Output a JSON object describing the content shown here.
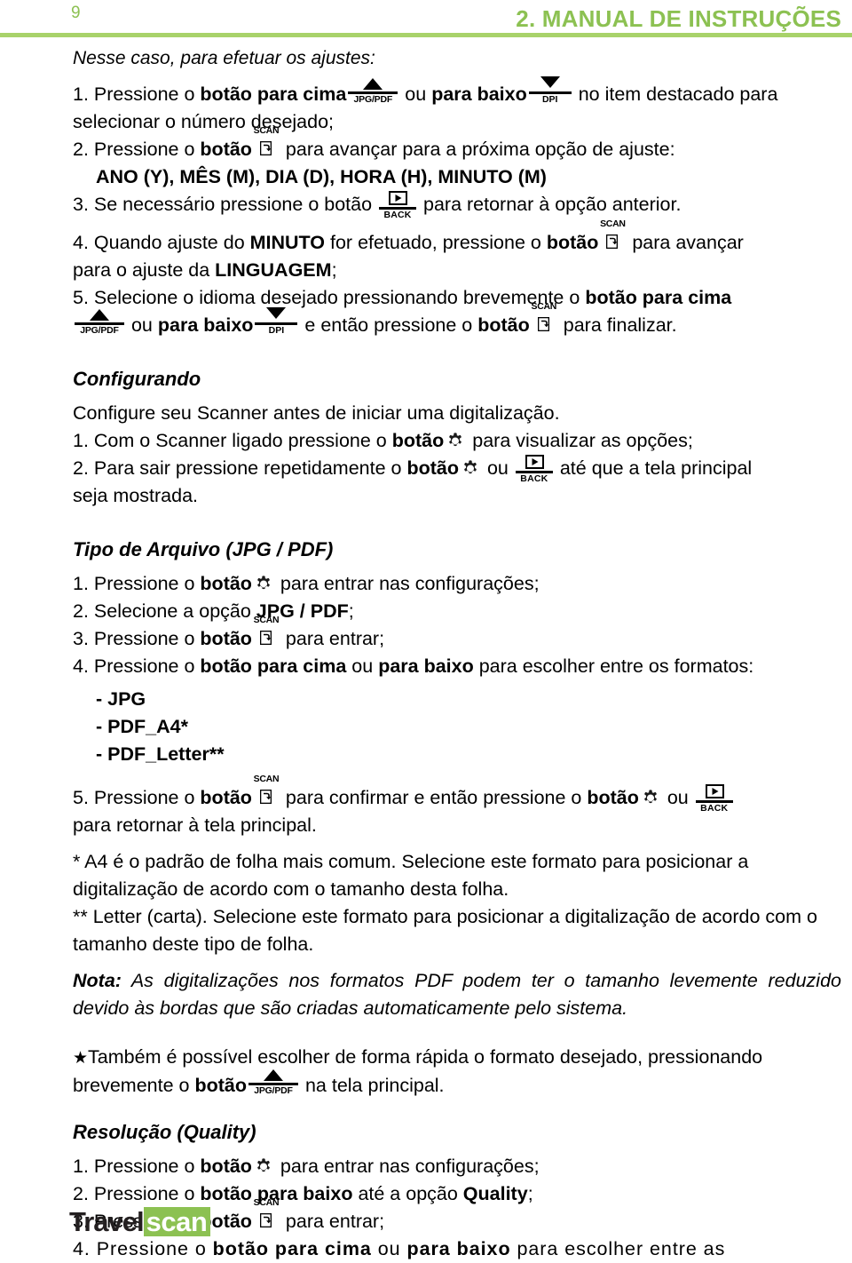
{
  "header": {
    "page_number": "9",
    "title": "2. MANUAL DE INSTRUÇÕES",
    "accent_color": "#8cc152",
    "rule_color": "#a8d26a"
  },
  "icons": {
    "scan_label": "SCAN",
    "back_label": "BACK",
    "up_label": "JPG/PDF",
    "down_label": "DPI",
    "gear_name": "gear-icon",
    "star_glyph": "★"
  },
  "body": {
    "intro_italic": "Nesse caso, para efetuar os ajustes:",
    "step1_a": "1. Pressione o ",
    "step1_b": "botão para cima",
    "step1_c": " ou ",
    "step1_d": "para baixo",
    "step1_e": " no item destacado para",
    "step1_cont": "selecionar o número desejado;",
    "step2_a": "2. Pressione o ",
    "step2_b": "botão",
    "step2_c": " para avançar para a próxima opção de ajuste:",
    "step2_list": "ANO (Y), MÊS (M), DIA (D), HORA (H), MINUTO (M)",
    "step3_a": "3. Se necessário pressione o botão ",
    "step3_b": " para retornar à opção anterior.",
    "step4_a": "4. Quando ajuste do ",
    "step4_b": "MINUTO",
    "step4_c": " for efetuado, pressione o ",
    "step4_d": "botão",
    "step4_e": " para avançar",
    "step4_cont_a": "para o ajuste da ",
    "step4_cont_b": "LINGUAGEM",
    "step4_cont_c": ";",
    "step5_a": "5. Selecione o idioma desejado pressionando brevemente o ",
    "step5_b": "botão para cima",
    "step5_c": " ou ",
    "step5_d": "para baixo",
    "step5_e": " e então pressione o ",
    "step5_f": "botão",
    "step5_g": " para finalizar."
  },
  "configurando": {
    "heading": "Configurando",
    "intro": "Configure seu Scanner antes de iniciar uma digitalização.",
    "item1_a": "1. Com o Scanner ligado pressione o ",
    "item1_b": "botão",
    "item1_c": " para visualizar as opções;",
    "item2_a": "2. Para sair pressione repetidamente o ",
    "item2_b": "botão",
    "item2_c": " ou ",
    "item2_d": " até que a tela principal",
    "item2_cont": "seja mostrada."
  },
  "tipo_arquivo": {
    "heading": "Tipo de Arquivo (JPG / PDF)",
    "item1_a": "1. Pressione o ",
    "item1_b": "botão",
    "item1_c": " para entrar nas configurações;",
    "item2_a": "2. Selecione a opção ",
    "item2_b": "JPG / PDF",
    "item2_c": ";",
    "item3_a": "3. Pressione o ",
    "item3_b": "botão",
    "item3_c": " para entrar;",
    "item4_a": "4. Pressione o ",
    "item4_b": "botão para cima",
    "item4_c": " ou ",
    "item4_d": "para baixo",
    "item4_e": " para escolher entre os formatos:",
    "formats": [
      "- JPG",
      "- PDF_A4*",
      "- PDF_Letter**"
    ],
    "item5_a": "5. Pressione o ",
    "item5_b": "botão",
    "item5_c": " para confirmar e então pressione o ",
    "item5_d": "botão",
    "item5_e": " ou ",
    "item5_cont": "para retornar à tela principal.",
    "note_a4": "*  A4 é o padrão de folha mais comum. Selecione este formato para posicionar a digitalização de acordo com o tamanho desta folha.",
    "note_letter": "** Letter (carta). Selecione este formato para posicionar a digitalização de acordo com o tamanho deste tipo de folha.",
    "nota_label": "Nota:",
    "nota_text": " As digitalizações nos formatos PDF podem ter o tamanho levemente reduzido devido às bordas que são criadas automaticamente pelo sistema.",
    "star_note_a": "Também é possível escolher de forma rápida o formato desejado, pressionando",
    "star_note_b": "brevemente o ",
    "star_note_c": "botão",
    "star_note_d": " na tela principal."
  },
  "resolucao": {
    "heading": "Resolução (Quality)",
    "item1_a": "1. Pressione o ",
    "item1_b": "botão",
    "item1_c": " para entrar nas configurações;",
    "item2_a": "2. Pressione o ",
    "item2_b": "botão para baixo",
    "item2_c": " até a opção ",
    "item2_d": "Quality",
    "item2_e": ";",
    "item3_a": "3. Pressione o ",
    "item3_b": "botão",
    "item3_c": " para entrar;",
    "item4_a": "4. Pressione o ",
    "item4_b": "botão para cima",
    "item4_c": " ou ",
    "item4_d": "para baixo",
    "item4_e": " para escolher entre as"
  },
  "footer": {
    "logo_part1": "Travel",
    "logo_part2": "scan",
    "logo_bg": "#8cc152"
  }
}
